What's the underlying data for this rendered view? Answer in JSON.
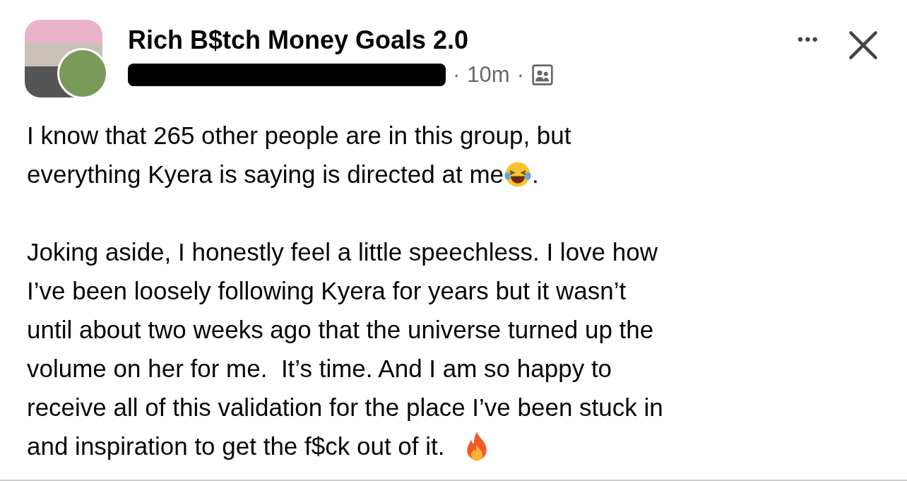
{
  "post": {
    "group_name": "Rich B$tch Money Goals 2.0",
    "author_redacted": true,
    "separator_1": "·",
    "time": "10m",
    "separator_2": "·",
    "more_button": "•••",
    "paragraphs": [
      {
        "lines": [
          "I know that 265 other people are in this group, but",
          "everything Kyera is saying is directed at me"
        ],
        "kind": "laughing",
        "tail": "."
      },
      {
        "lines": [
          "Joking aside, I honestly feel a little speechless. I love how",
          "I’ve been loosely following Kyera for years but it wasn’t",
          "until about two weeks ago that the universe turned up the",
          "volume on her for me.  It’s time. And I am so happy to",
          "receive all of this validation for the place I’ve been stuck in",
          "and inspiration to get the f$ck out of it."
        ],
        "kind": "fire"
      }
    ]
  }
}
